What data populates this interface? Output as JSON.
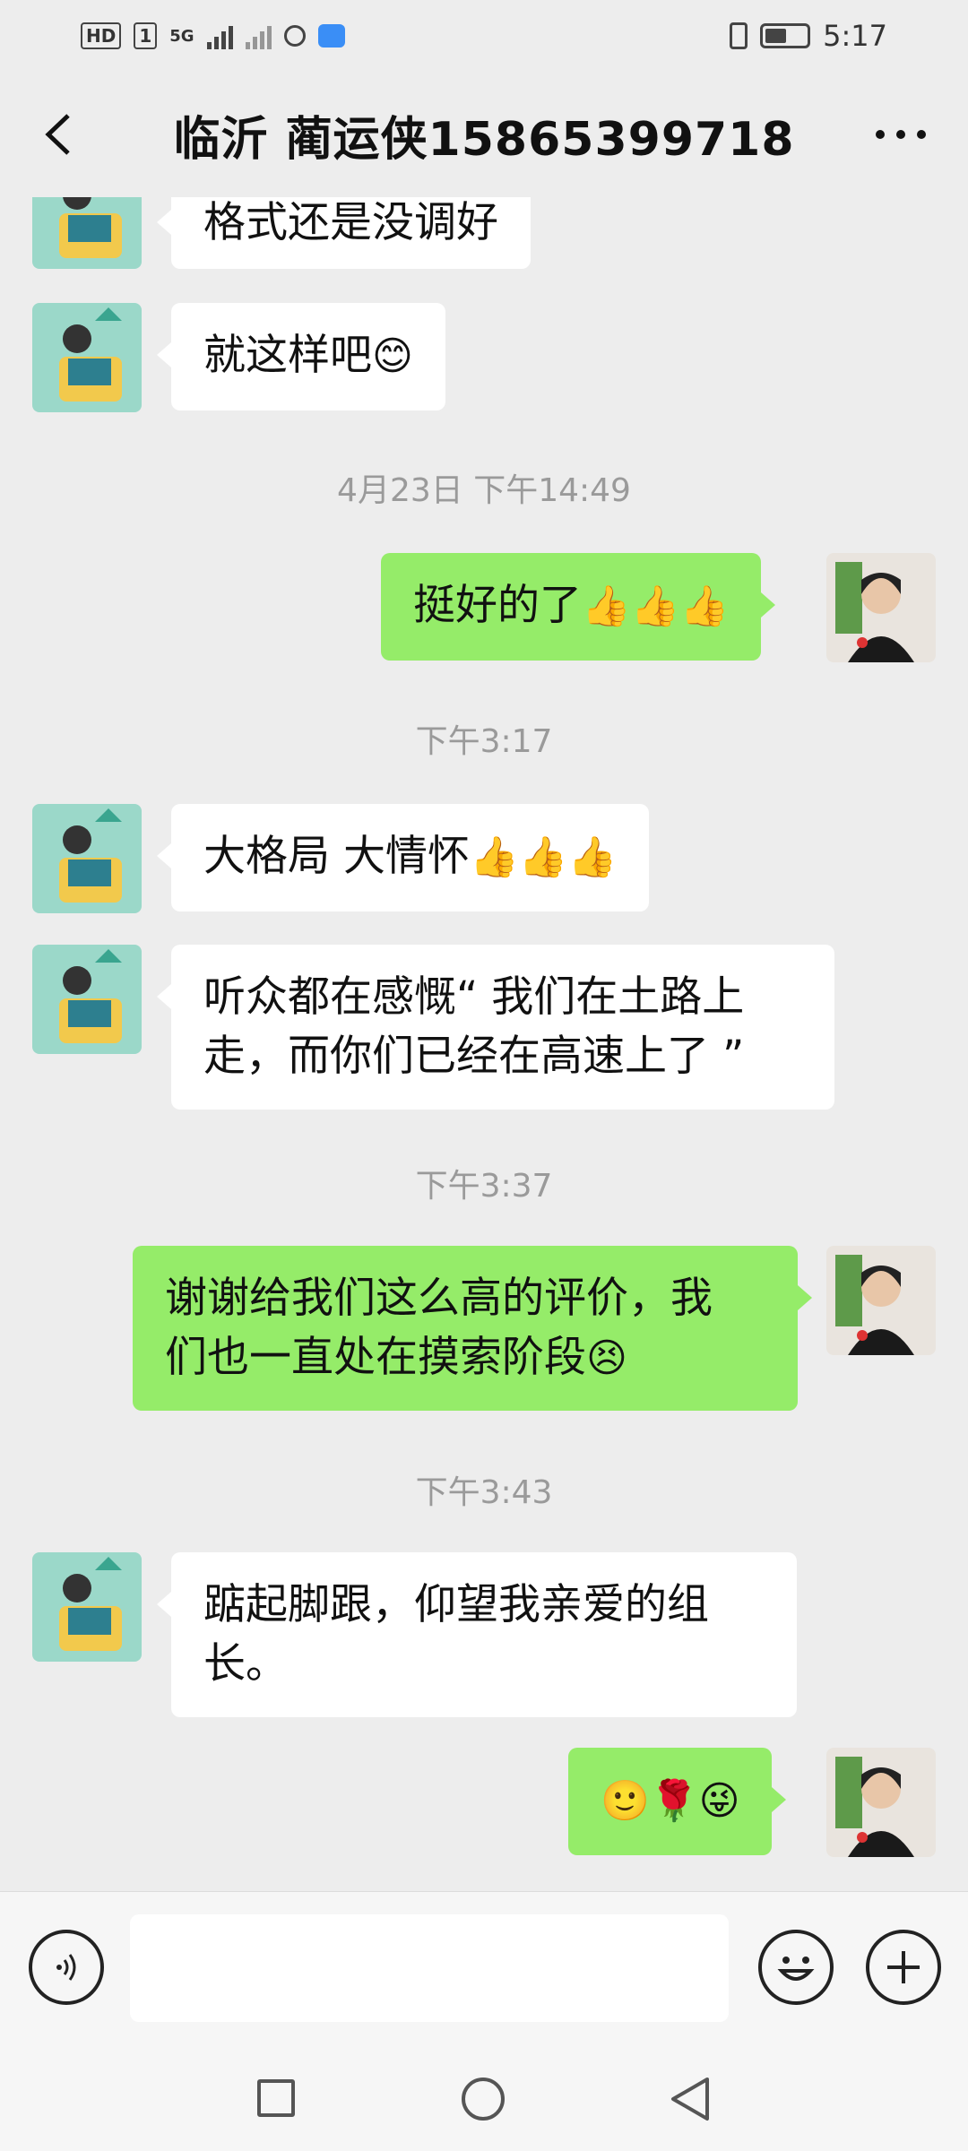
{
  "status_bar": {
    "hd_label": "HD",
    "sim_label": "1",
    "network_label": "5G",
    "time": "5:17"
  },
  "header": {
    "title": "临沂 蔺运侠15865399718"
  },
  "messages": [
    {
      "type": "in",
      "text": "格式还是没调好",
      "emoji": ""
    },
    {
      "type": "in",
      "text": "就这样吧",
      "emoji": "😊"
    },
    {
      "type": "time",
      "text": "4月23日 下午14:49"
    },
    {
      "type": "out",
      "text": "挺好的了",
      "emoji": "👍👍👍"
    },
    {
      "type": "time",
      "text": "下午3:17"
    },
    {
      "type": "in",
      "text": "大格局 大情怀",
      "emoji": "👍👍👍"
    },
    {
      "type": "in",
      "line1": "听众都在感慨“ 我们在土路上",
      "line2": "走，而你们已经在高速上了 ”"
    },
    {
      "type": "time",
      "text": "下午3:37"
    },
    {
      "type": "out",
      "line1": "谢谢给我们这么高的评价，我",
      "line2": "们也一直处在摸索阶段",
      "emoji": "😣"
    },
    {
      "type": "time",
      "text": "下午3:43"
    },
    {
      "type": "in",
      "line1": "踮起脚跟，仰望我亲爱的组",
      "line2": "长。"
    },
    {
      "type": "out",
      "emoji": "🙂🌹😜"
    }
  ],
  "colors": {
    "background": "#ededed",
    "bubble_out": "#95ec69",
    "bubble_in": "#ffffff",
    "timestamp": "#9a9a9a"
  }
}
